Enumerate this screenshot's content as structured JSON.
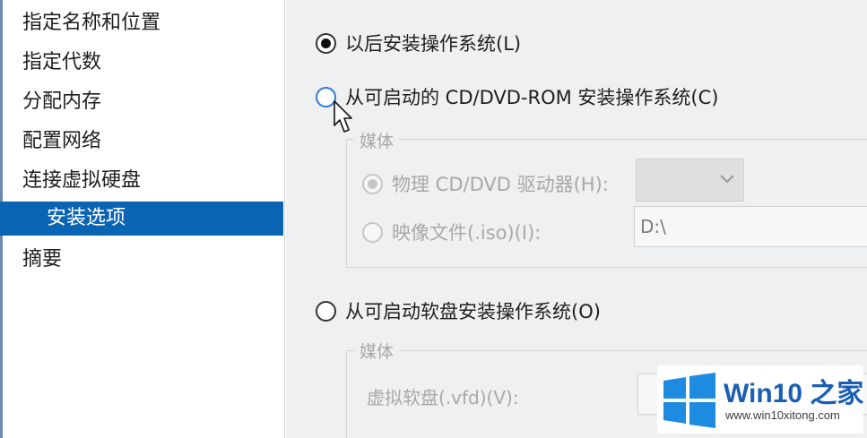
{
  "nav": {
    "items": [
      {
        "label": "指定名称和位置",
        "selected": false
      },
      {
        "label": "指定代数",
        "selected": false
      },
      {
        "label": "分配内存",
        "selected": false
      },
      {
        "label": "配置网络",
        "selected": false
      },
      {
        "label": "连接虚拟硬盘",
        "selected": false
      },
      {
        "label": "安装选项",
        "selected": true
      },
      {
        "label": "摘要",
        "selected": false
      }
    ]
  },
  "options": {
    "install_later": {
      "label": "以后安装操作系统(L)",
      "checked": true
    },
    "install_from_cd": {
      "label": "从可启动的 CD/DVD-ROM 安装操作系统(C)",
      "checked": false
    },
    "install_from_floppy": {
      "label": "从可启动软盘安装操作系统(O)",
      "checked": false
    }
  },
  "cd_media": {
    "group_title": "媒体",
    "physical_drive_label": "物理 CD/DVD 驱动器(H):",
    "physical_drive_value": "",
    "image_file_label": "映像文件(.iso)(I):",
    "image_file_value": "D:\\"
  },
  "floppy_media": {
    "group_title": "媒体",
    "virtual_floppy_label": "虚拟软盘(.vfd)(V):",
    "virtual_floppy_value": ""
  },
  "watermark": {
    "title": "Win10 之家",
    "url": "www.win10xitong.com"
  },
  "colors": {
    "selection_blue": "#0a64b4",
    "panel_background": "#eef0f2",
    "disabled_text": "#a8a8a8",
    "watermark_blue": "#1a5fb4"
  },
  "icons": {
    "cursor": "mouse-pointer-icon",
    "combo_arrow": "chevron-down-icon",
    "watermark_logo": "windows-logo-icon"
  }
}
